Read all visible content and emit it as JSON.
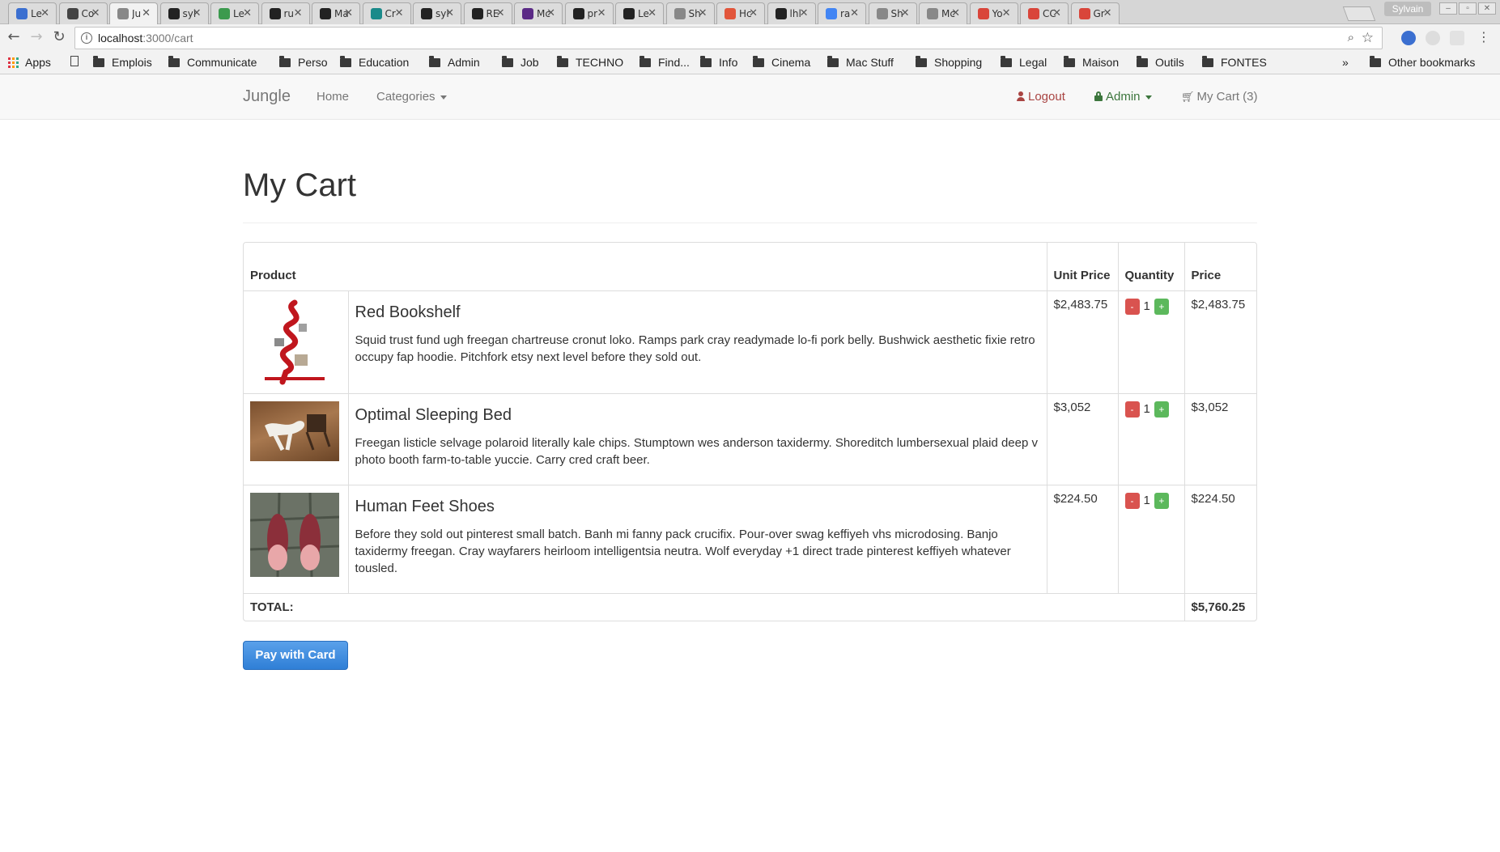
{
  "browser": {
    "tabs": [
      {
        "title": "Le",
        "active": false
      },
      {
        "title": "Co",
        "active": false
      },
      {
        "title": "Ju",
        "active": true
      },
      {
        "title": "syl",
        "active": false
      },
      {
        "title": "Le",
        "active": false
      },
      {
        "title": "ru",
        "active": false
      },
      {
        "title": "Ma",
        "active": false
      },
      {
        "title": "Cr",
        "active": false
      },
      {
        "title": "syl",
        "active": false
      },
      {
        "title": "RE",
        "active": false
      },
      {
        "title": "Mc",
        "active": false
      },
      {
        "title": "pr",
        "active": false
      },
      {
        "title": "Le",
        "active": false
      },
      {
        "title": "Sh",
        "active": false
      },
      {
        "title": "Hc",
        "active": false
      },
      {
        "title": "lhl",
        "active": false
      },
      {
        "title": "ra",
        "active": false
      },
      {
        "title": "Sh",
        "active": false
      },
      {
        "title": "Mc",
        "active": false
      },
      {
        "title": "Yo",
        "active": false
      },
      {
        "title": "CC",
        "active": false
      },
      {
        "title": "Gr",
        "active": false
      }
    ],
    "profile_name": "Sylvain",
    "url_host": "localhost",
    "url_path": ":3000/cart",
    "bookmarks": {
      "apps": "Apps",
      "folders": [
        "Emplois",
        "Communicate",
        "Perso",
        "Education",
        "Admin",
        "Job",
        "TECHNO",
        "Find...",
        "Info",
        "Cinema",
        "Mac Stuff",
        "Shopping",
        "Legal",
        "Maison",
        "Outils",
        "FONTES"
      ],
      "overflow": "»",
      "other": "Other bookmarks"
    }
  },
  "navbar": {
    "brand": "Jungle",
    "home": "Home",
    "categories": "Categories",
    "logout": "Logout",
    "admin": "Admin",
    "cart": "My Cart (3)"
  },
  "page": {
    "title": "My Cart",
    "table": {
      "headers": {
        "product": "Product",
        "unit_price": "Unit Price",
        "quantity": "Quantity",
        "price": "Price"
      },
      "rows": [
        {
          "name": "Red Bookshelf",
          "description": "Squid trust fund ugh freegan chartreuse cronut loko. Ramps park cray readymade lo-fi pork belly. Bushwick aesthetic fixie retro occupy fap hoodie. Pitchfork etsy next level before they sold out.",
          "unit_price": "$2,483.75",
          "quantity": "1",
          "price": "$2,483.75"
        },
        {
          "name": "Optimal Sleeping Bed",
          "description": "Freegan listicle selvage polaroid literally kale chips. Stumptown wes anderson taxidermy. Shoreditch lumbersexual plaid deep v photo booth farm-to-table yuccie. Carry cred craft beer.",
          "unit_price": "$3,052",
          "quantity": "1",
          "price": "$3,052"
        },
        {
          "name": "Human Feet Shoes",
          "description": "Before they sold out pinterest small batch. Banh mi fanny pack crucifix. Pour-over swag keffiyeh vhs microdosing. Banjo taxidermy freegan. Cray wayfarers heirloom intelligentsia neutra. Wolf everyday +1 direct trade pinterest keffiyeh whatever tousled.",
          "unit_price": "$224.50",
          "quantity": "1",
          "price": "$224.50"
        }
      ],
      "minus_label": "-",
      "plus_label": "+",
      "total_label": "TOTAL:",
      "total_value": "$5,760.25"
    },
    "pay_button": "Pay with Card"
  }
}
